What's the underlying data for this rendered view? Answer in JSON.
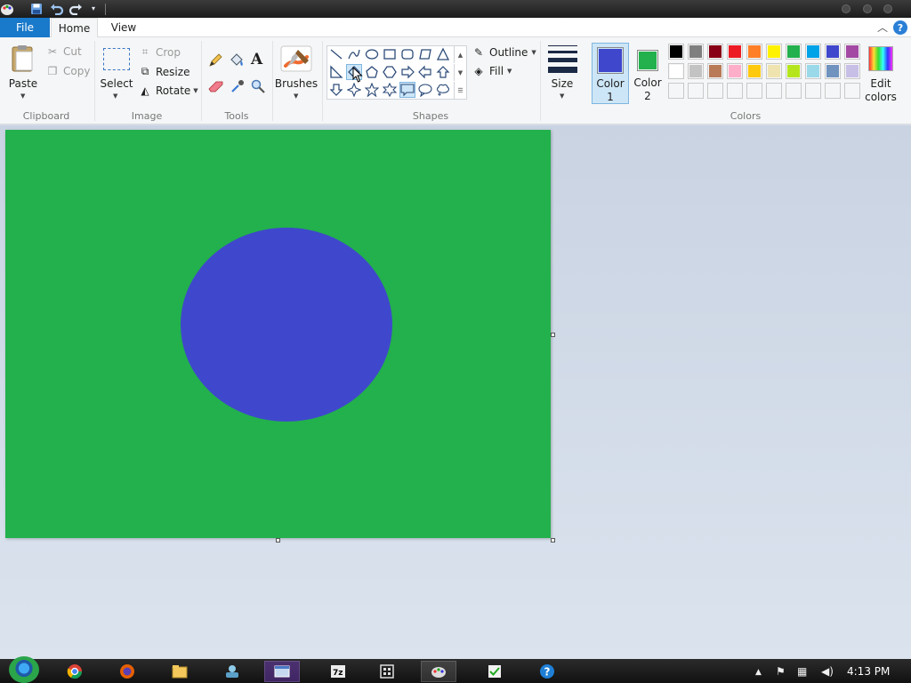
{
  "app": {
    "tabs": {
      "file": "File",
      "home": "Home",
      "view": "View"
    },
    "help": "?"
  },
  "clipboard": {
    "paste": "Paste",
    "cut": "Cut",
    "copy": "Copy",
    "group": "Clipboard"
  },
  "image": {
    "select": "Select",
    "crop": "Crop",
    "resize": "Resize",
    "rotate": "Rotate",
    "group": "Image"
  },
  "tools": {
    "group": "Tools",
    "text_tool": "A"
  },
  "brushes": {
    "label": "Brushes"
  },
  "shapes": {
    "group": "Shapes",
    "outline": "Outline",
    "fill": "Fill"
  },
  "size": {
    "label": "Size"
  },
  "colors": {
    "group": "Colors",
    "color1_label": "Color",
    "color1_num": "1",
    "color2_label": "Color",
    "color2_num": "2",
    "edit_label_1": "Edit",
    "edit_label_2": "colors",
    "color1": "#3f48cc",
    "color2": "#22b14c",
    "palette": [
      "#000000",
      "#7f7f7f",
      "#880015",
      "#ed1c24",
      "#ff7f27",
      "#fff200",
      "#22b14c",
      "#00a2e8",
      "#3f48cc",
      "#a349a4",
      "#ffffff",
      "#c3c3c3",
      "#b97a57",
      "#ffaec9",
      "#ffc90e",
      "#efe4b0",
      "#b5e61d",
      "#99d9ea",
      "#7092be",
      "#c8bfe7"
    ]
  },
  "canvas": {
    "background": "#22b14c",
    "ellipse_fill": "#3f48cc"
  },
  "taskbar": {
    "clock": "4:13 PM"
  }
}
